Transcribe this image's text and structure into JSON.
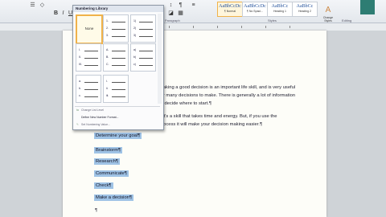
{
  "ribbon": {
    "styles": [
      {
        "sample": "AaBbCcDc",
        "name": "¶ Normal",
        "active": true
      },
      {
        "sample": "AaBbCcDc",
        "name": "¶ No Spaci...",
        "active": false
      },
      {
        "sample": "AaBbCc",
        "name": "Heading 1",
        "active": false
      },
      {
        "sample": "AaBbCc",
        "name": "Heading 2",
        "active": false
      }
    ],
    "change_styles_label": "Change Styles",
    "group_paragraph": "Paragraph",
    "group_styles": "Styles",
    "group_editing": "Editing"
  },
  "numbering_library": {
    "title": "Numbering Library",
    "none_label": "None",
    "formats": [
      [
        "1.",
        "2.",
        "3."
      ],
      [
        "1)",
        "2)",
        "3)"
      ],
      [
        "I.",
        "II.",
        "III."
      ],
      [
        "A.",
        "B.",
        "C."
      ],
      [
        "a)",
        "b)",
        "c)"
      ],
      [
        "a.",
        "b.",
        "c."
      ],
      [
        "i.",
        "ii.",
        "iii."
      ],
      [
        "",
        "",
        ""
      ]
    ],
    "menu": [
      {
        "label": "Change List Level",
        "enabled": false
      },
      {
        "label": "Define New Number Format...",
        "enabled": true
      },
      {
        "label": "Set Numbering Value...",
        "enabled": false
      }
    ]
  },
  "document": {
    "para1": [
      "Making a good decision is an important life skill, and is very useful",
      "for many decisions to make. There is generally a lot of information",
      "to decide where to start.¶"
    ],
    "para2": [
      "It's a skill that takes time and energy. But, if you use the",
      "process it will make your decision making easier.¶"
    ],
    "steps": [
      "Determine your goal¶",
      "Brainstorm¶",
      "Research¶",
      "Communicate¶",
      "Check¶",
      "Make a decision¶"
    ],
    "trailing_mark": "¶"
  }
}
